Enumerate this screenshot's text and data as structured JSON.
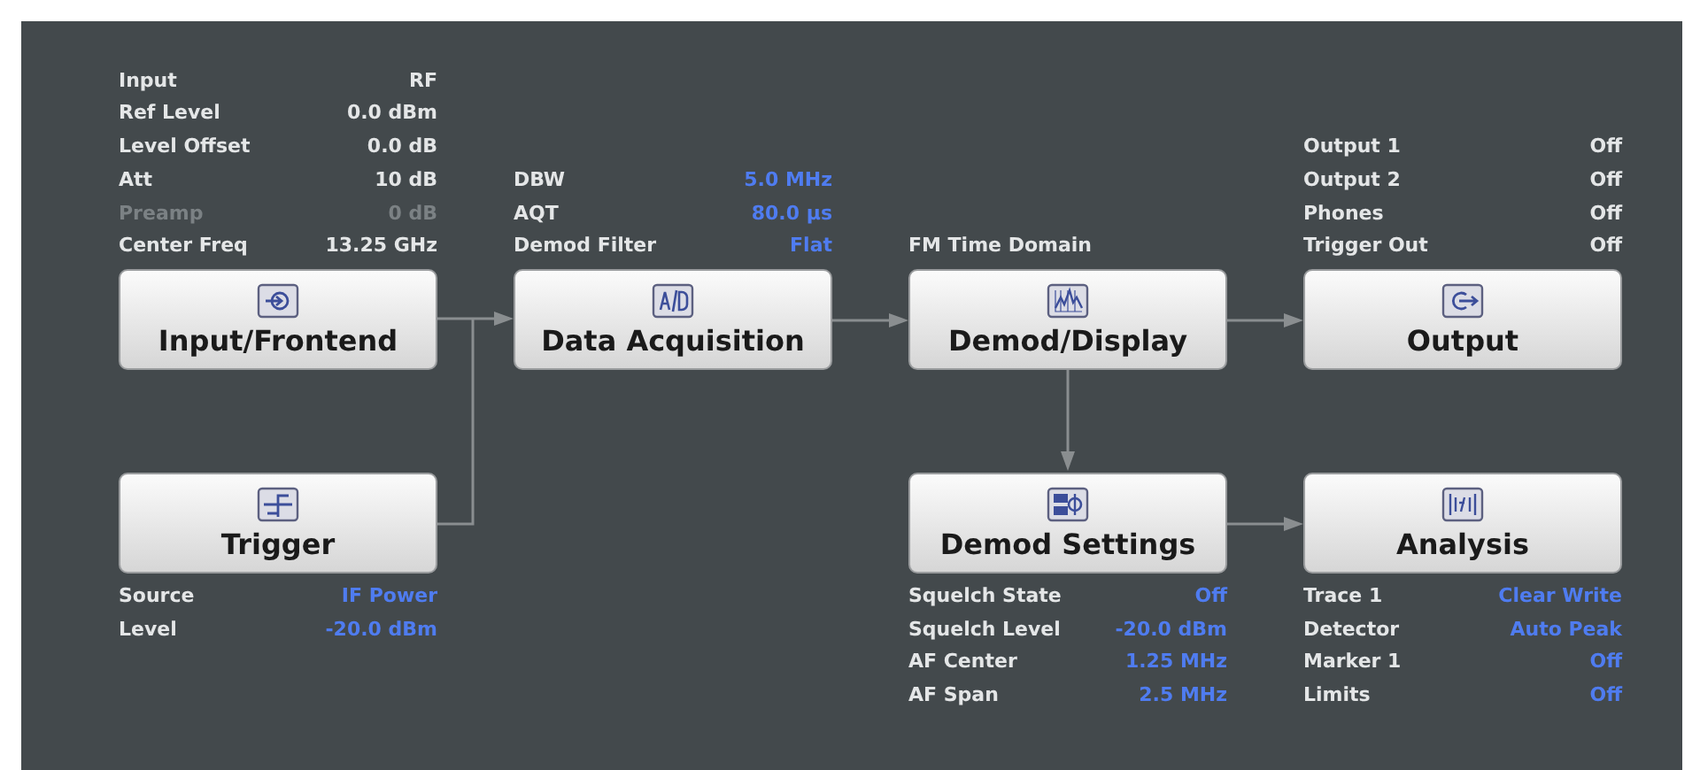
{
  "top_row": [
    {
      "title": "Input/Frontend",
      "kind": "input",
      "settings": [
        {
          "label": "Input",
          "value": "RF",
          "highlighted": false,
          "disabled": false
        },
        {
          "label": "Ref Level",
          "value": "0.0 dBm",
          "highlighted": false,
          "disabled": false
        },
        {
          "label": "Level Offset",
          "value": "0.0 dB",
          "highlighted": false,
          "disabled": false
        },
        {
          "label": "Att",
          "value": "10 dB",
          "highlighted": false,
          "disabled": false
        },
        {
          "label": "Preamp",
          "value": "0 dB",
          "highlighted": false,
          "disabled": true
        },
        {
          "label": "Center Freq",
          "value": "13.25 GHz",
          "highlighted": false,
          "disabled": false
        }
      ]
    },
    {
      "title": "Data Acquisition",
      "kind": "ad",
      "settings": [
        {
          "label": "DBW",
          "value": "5.0 MHz",
          "highlighted": true,
          "disabled": false
        },
        {
          "label": "AQT",
          "value": "80.0 µs",
          "highlighted": true,
          "disabled": false
        },
        {
          "label": "Demod Filter",
          "value": "Flat",
          "highlighted": true,
          "disabled": false
        }
      ]
    },
    {
      "title": "Demod/Display",
      "kind": "display",
      "caption": "FM Time Domain"
    },
    {
      "title": "Output",
      "kind": "output",
      "settings": [
        {
          "label": "Output 1",
          "value": "Off",
          "highlighted": false,
          "disabled": false
        },
        {
          "label": "Output 2",
          "value": "Off",
          "highlighted": false,
          "disabled": false
        },
        {
          "label": "Phones",
          "value": "Off",
          "highlighted": false,
          "disabled": false
        },
        {
          "label": "Trigger Out",
          "value": "Off",
          "highlighted": false,
          "disabled": false
        }
      ]
    }
  ],
  "bottom_row": [
    {
      "title": "Trigger",
      "kind": "trigger",
      "settings": [
        {
          "label": "Source",
          "value": "IF Power",
          "highlighted": true,
          "disabled": false
        },
        {
          "label": "Level",
          "value": "-20.0 dBm",
          "highlighted": true,
          "disabled": false
        }
      ]
    },
    {
      "title": "Demod Settings",
      "kind": "demod",
      "settings": [
        {
          "label": "Squelch State",
          "value": "Off",
          "highlighted": true,
          "disabled": false
        },
        {
          "label": "Squelch Level",
          "value": "-20.0 dBm",
          "highlighted": true,
          "disabled": false
        },
        {
          "label": "AF Center",
          "value": "1.25 MHz",
          "highlighted": true,
          "disabled": false
        },
        {
          "label": "AF Span",
          "value": "2.5 MHz",
          "highlighted": true,
          "disabled": false
        }
      ]
    },
    {
      "title": "Analysis",
      "kind": "analysis",
      "settings": [
        {
          "label": "Trace 1",
          "value": "Clear Write",
          "highlighted": true,
          "disabled": false
        },
        {
          "label": "Detector",
          "value": "Auto Peak",
          "highlighted": true,
          "disabled": false
        },
        {
          "label": "Marker 1",
          "value": "Off",
          "highlighted": true,
          "disabled": false
        },
        {
          "label": "Limits",
          "value": "Off",
          "highlighted": true,
          "disabled": false
        }
      ]
    }
  ]
}
